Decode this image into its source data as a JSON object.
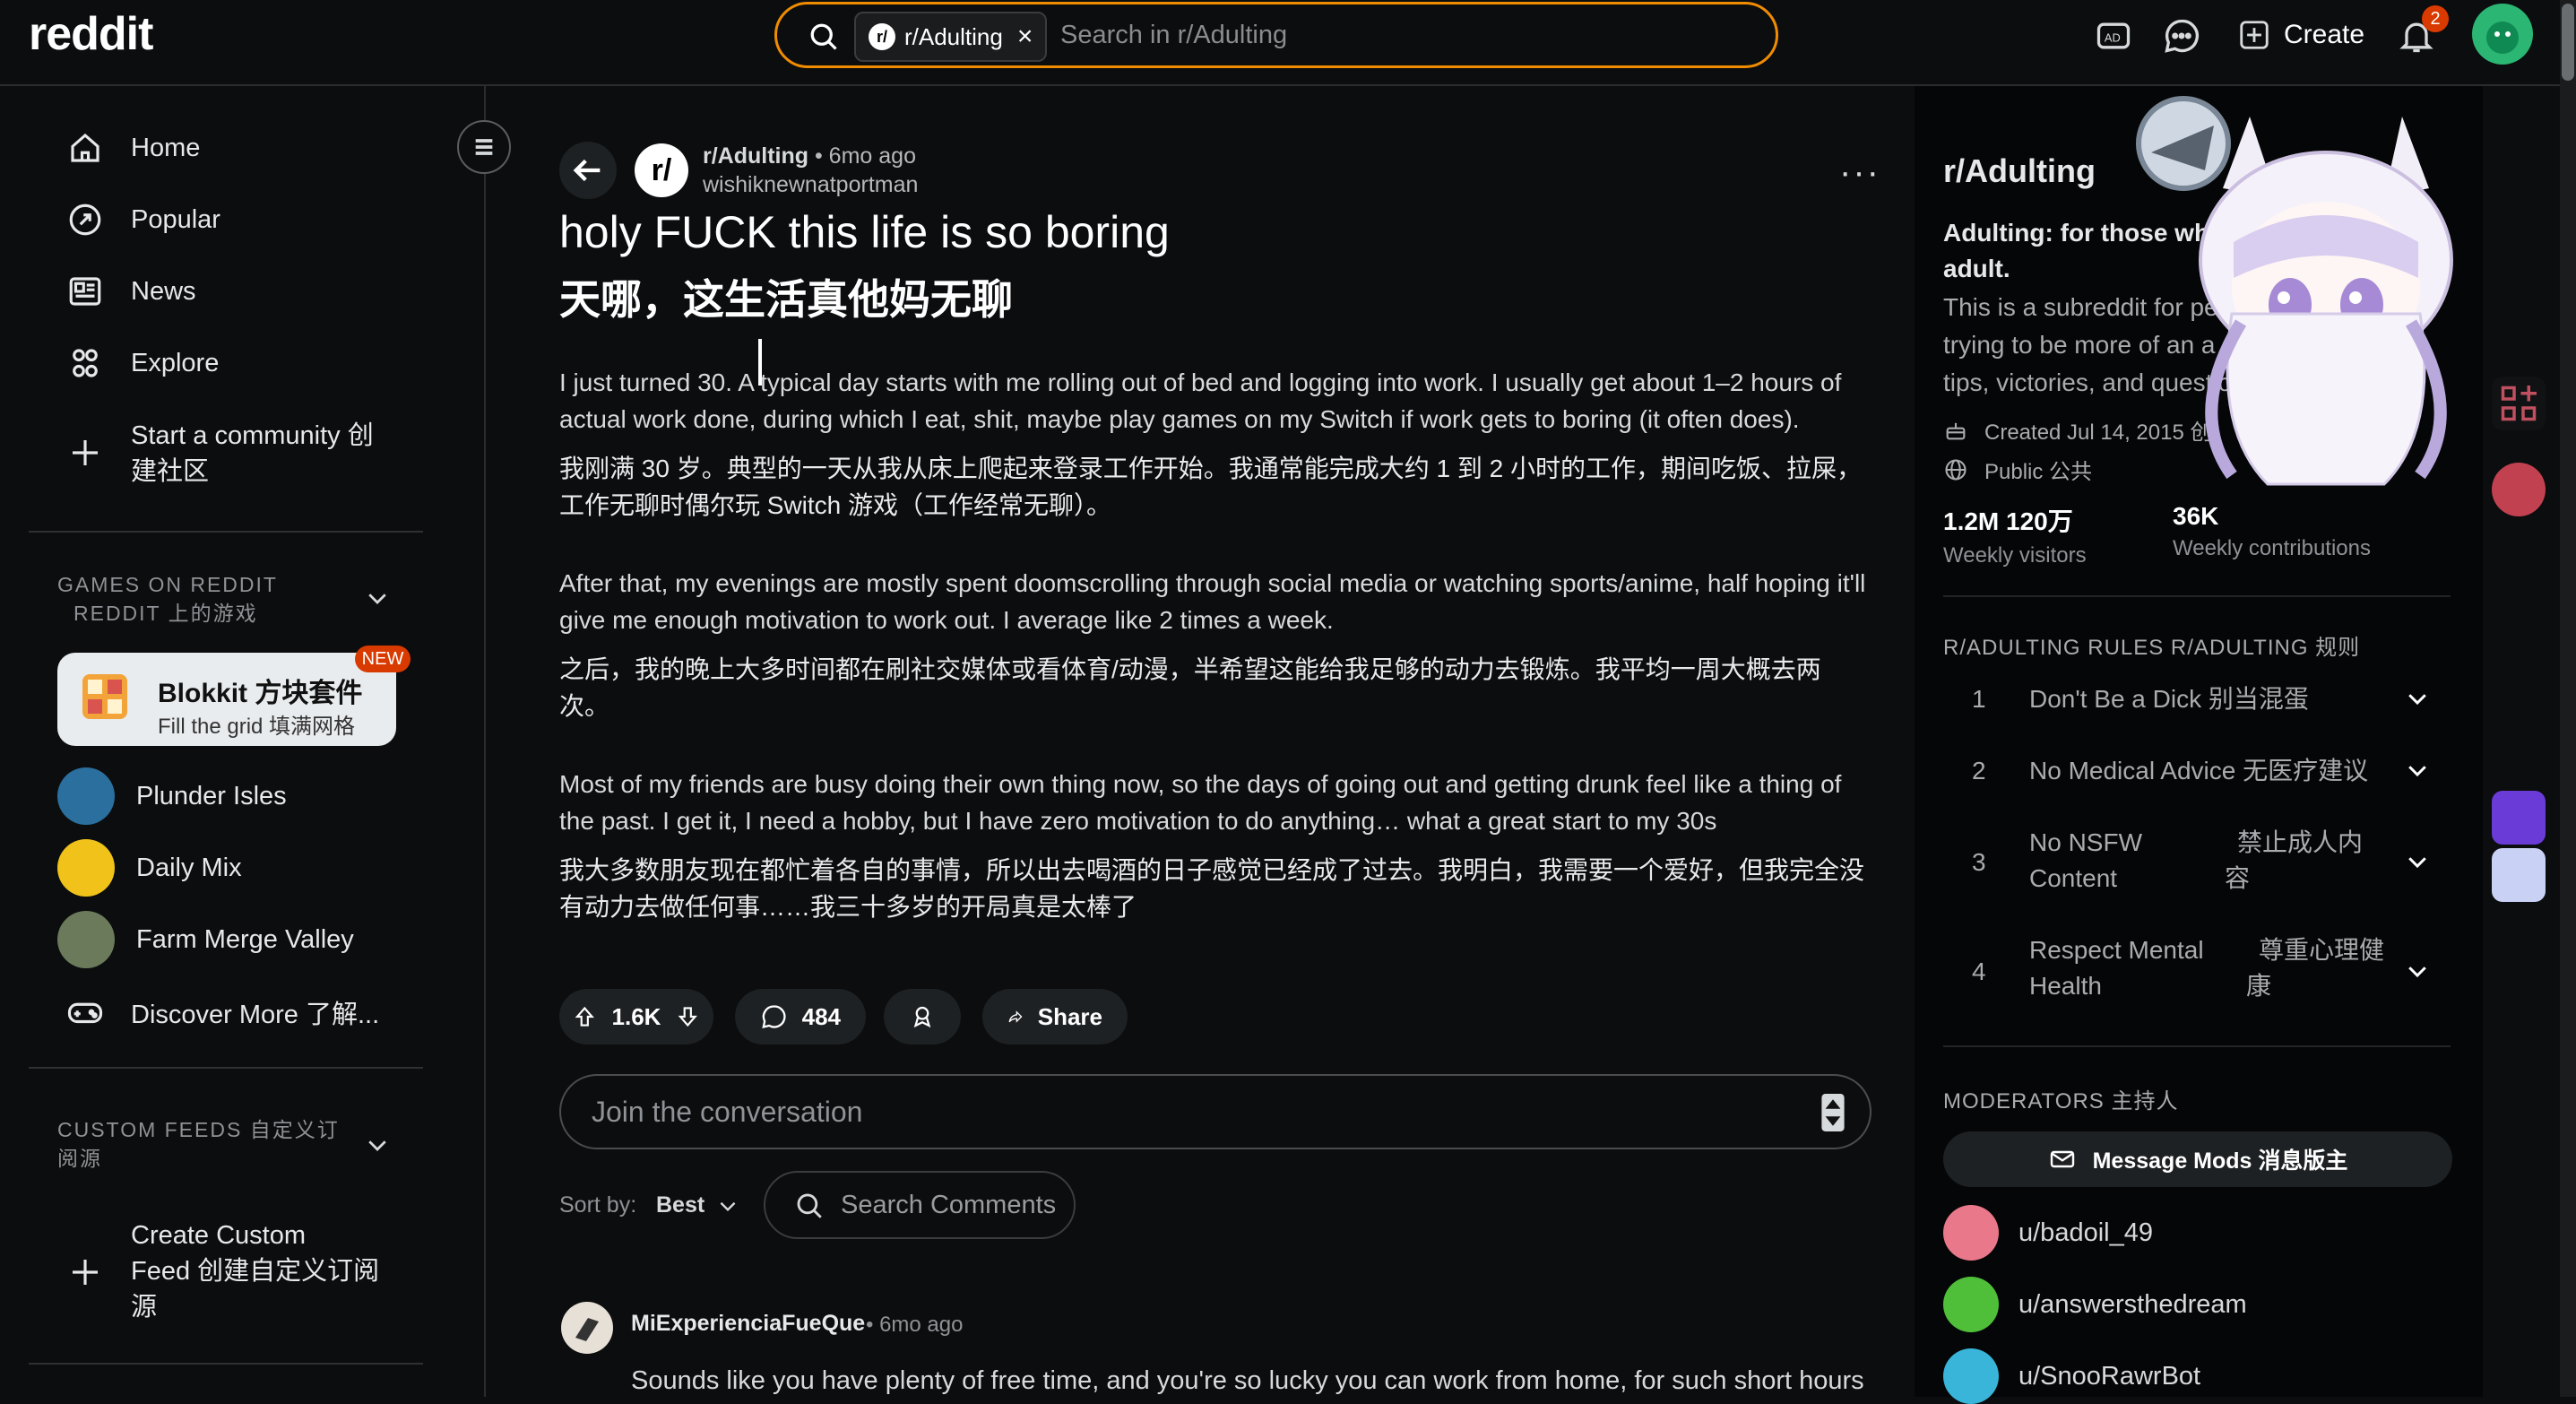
{
  "header": {
    "logo": "reddit",
    "search_chip": "r/Adulting",
    "search_placeholder": "Search in r/Adulting",
    "create_label": "Create",
    "notification_count": "2"
  },
  "sidebar": {
    "nav": [
      {
        "label": "Home",
        "icon": "home-icon"
      },
      {
        "label": "Popular",
        "icon": "popular-icon"
      },
      {
        "label": "News",
        "icon": "news-icon"
      },
      {
        "label": "Explore",
        "icon": "explore-icon"
      }
    ],
    "start_community_line1": "Start a community  创",
    "start_community_line2": "建社区",
    "games_header_line1": "GAMES ON REDDIT",
    "games_header_line2": "REDDIT 上的游戏",
    "blokkit_title": "Blokkit  方块套件",
    "blokkit_sub": "Fill the grid   填满网格",
    "new_badge": "NEW",
    "games": [
      "Plunder Isles",
      "Daily Mix",
      "Farm Merge Valley"
    ],
    "discover": "Discover More  了解...",
    "custom_header_line1": "CUSTOM FEEDS   自定义订",
    "custom_header_line2": "阅源",
    "create_feed_line1": "Create Custom",
    "create_feed_line2": "Feed  创建自定义订阅",
    "create_feed_line3": "源"
  },
  "post": {
    "subreddit": "r/Adulting",
    "time": "• 6mo ago",
    "author": "wishiknewnatportman",
    "title": "holy FUCK this life is so boring",
    "title_zh": "天哪，这生活真他妈无聊",
    "p1": "I just turned 30. A typical day starts with me rolling out of bed and logging into work. I usually get about 1–2 hours of actual work done, during which I eat, shit, maybe play games on my Switch if work gets to boring (it often does).",
    "p1_zh": "我刚满 30 岁。典型的一天从我从床上爬起来登录工作开始。我通常能完成大约 1 到 2 小时的工作，期间吃饭、拉屎，工作无聊时偶尔玩 Switch 游戏（工作经常无聊）。",
    "p2": "After that, my evenings are mostly spent doomscrolling through social media or watching sports/anime, half hoping it'll give me enough motivation to work out. I average like 2 times a week.",
    "p2_zh": "之后，我的晚上大多时间都在刷社交媒体或看体育/动漫，半希望这能给我足够的动力去锻炼。我平均一周大概去两次。",
    "p3": "Most of my friends are busy doing their own thing now, so the days of going out and getting drunk feel like a thing of the past. I get it, I need a hobby, but I have zero motivation to do anything… what a great start to my 30s",
    "p3_zh": "我大多数朋友现在都忙着各自的事情，所以出去喝酒的日子感觉已经成了过去。我明白，我需要一个爱好，但我完全没有动力去做任何事……我三十多岁的开局真是太棒了",
    "votes": "1.6K",
    "comments": "484",
    "share": "Share"
  },
  "comments": {
    "join_placeholder": "Join the conversation",
    "sort_label": "Sort by:",
    "sort_value": "Best",
    "search_placeholder": "Search Comments",
    "first": {
      "user": "MiExperienciaFueQue",
      "time": "• 6mo ago",
      "text": "Sounds like you have plenty of free time, and you're so lucky you can work from home, for such short hours"
    }
  },
  "right": {
    "title": "r/Adulting",
    "subtitle": "Adulting: for those who",
    "subtitle2": "adult.",
    "desc1": "This is a subreddit for pe",
    "desc2": "trying to be more of an a",
    "desc3": "tips, victories, and questio",
    "created": "Created Jul 14, 2015  创",
    "public": "Public  公共",
    "stat1_n": "1.2M   120万",
    "stat1_l": "Weekly visitors",
    "stat2_n": "36K",
    "stat2_l": "Weekly contributions",
    "rules_header": "R/ADULTING RULES   R/ADULTING 规则",
    "rules": [
      {
        "n": "1",
        "a": "Don't Be a Dick  别当混蛋"
      },
      {
        "n": "2",
        "a": "No Medical Advice  无医疗建议"
      },
      {
        "n": "3",
        "a1": "No NSFW",
        "a2": "Content",
        "b1": "禁止成人内",
        "b2": "容"
      },
      {
        "n": "4",
        "a1": "Respect Mental",
        "a2": "Health",
        "b1": "尊重心理健",
        "b2": "康"
      }
    ],
    "moderators_header": "MODERATORS  主持人",
    "message_mods": "Message Mods    消息版主",
    "mods": [
      "u/badoil_49",
      "u/answersthedream",
      "u/SnooRawrBot"
    ]
  }
}
